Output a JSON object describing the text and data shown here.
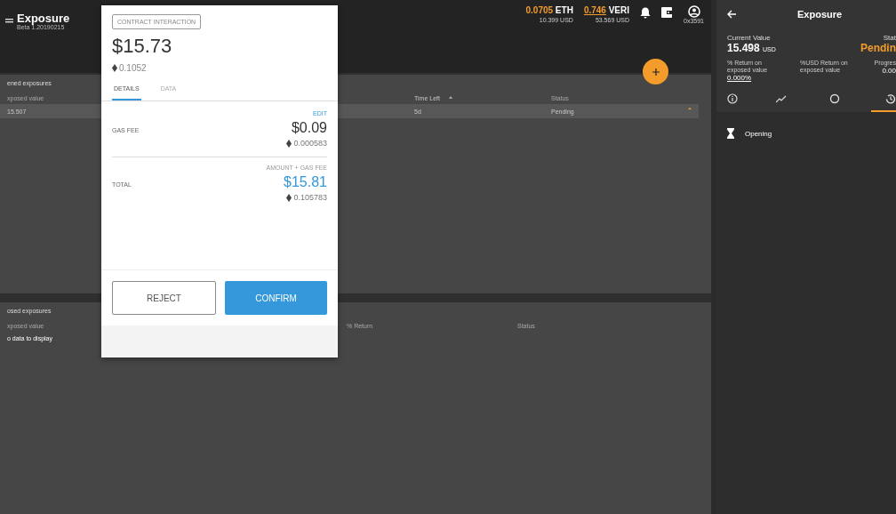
{
  "app_bar": {
    "title": "Exposure",
    "version": "Beta 1.20190215",
    "balances": [
      {
        "amount": "0.0705",
        "unit": "ETH",
        "usd": "10.399 USD",
        "underlined": false
      },
      {
        "amount": "0.746",
        "unit": "VERI",
        "usd": "53.569 USD",
        "underlined": true
      }
    ],
    "account": "0x3591"
  },
  "opened_exposures": {
    "title": "ened exposures",
    "columns": [
      {
        "label": "xposed value",
        "sorted": false
      },
      {
        "label": "Time Left",
        "sorted": true
      },
      {
        "label": "Status",
        "sorted": false
      }
    ],
    "rows": [
      {
        "cells": [
          "15.507",
          "5d",
          "Pending"
        ]
      }
    ]
  },
  "closed_exposures": {
    "title": "osed exposures",
    "columns": [
      "xposed value",
      "% Return",
      "Status"
    ],
    "empty_text": "o data to display"
  },
  "dialog": {
    "badge": "CONTRACT INTERACTION",
    "amount": "$15.73",
    "amount_eth": "0.1052",
    "tabs": [
      {
        "label": "DETAILS",
        "selected": true
      },
      {
        "label": "DATA",
        "selected": false
      }
    ],
    "edit": "EDIT",
    "gas_label": "GAS FEE",
    "gas_usd": "$0.09",
    "gas_eth": "0.000583",
    "total_caption": "AMOUNT + GAS FEE",
    "total_label": "TOTAL",
    "total_usd": "$15.81",
    "total_eth": "0.105783",
    "buttons": [
      {
        "label": "REJECT",
        "kind": "outline"
      },
      {
        "label": "CONFIRM",
        "kind": "primary"
      }
    ]
  },
  "side_panel": {
    "title": "Exposure",
    "current_value_label": "Current Value",
    "current_value": "15.498",
    "current_unit": "USD",
    "status_label": "Stat",
    "status": "Pendin",
    "stats": [
      {
        "label": "% Return on exposed value",
        "value": "0.000%"
      },
      {
        "label": "%USD Return on exposed value"
      },
      {
        "label": "Progres",
        "value": "0.00"
      }
    ],
    "tabs": [
      {
        "kind": "info",
        "selected": false
      },
      {
        "kind": "chart",
        "selected": false
      },
      {
        "kind": "circle",
        "selected": false
      },
      {
        "kind": "history",
        "selected": true
      }
    ],
    "events": [
      {
        "label": "Opening"
      }
    ]
  }
}
